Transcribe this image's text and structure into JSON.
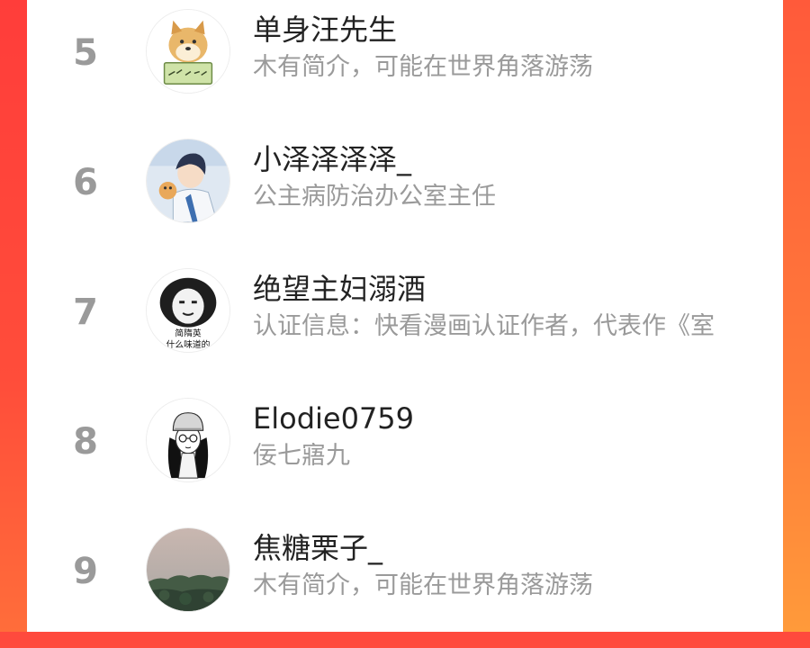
{
  "ranking": {
    "items": [
      {
        "rank": "5",
        "name": "单身汪先生",
        "bio": "木有简介，可能在世界角落游荡",
        "avatar": "doge-meme-avatar"
      },
      {
        "rank": "6",
        "name": "小泽泽泽泽_",
        "bio": "公主病防治办公室主任",
        "avatar": "anime-boy-avatar"
      },
      {
        "rank": "7",
        "name": "绝望主妇溺酒",
        "bio": "认证信息：快看漫画认证作者，代表作《室",
        "avatar": "panda-meme-avatar",
        "avatar_text": [
          "简隋英",
          "什么味道的"
        ]
      },
      {
        "rank": "8",
        "name": "Elodie0759",
        "bio": "佞七寤九",
        "avatar": "sketch-girl-avatar"
      },
      {
        "rank": "9",
        "name": "焦糖栗子_",
        "bio": "木有简介，可能在世界角落游荡",
        "avatar": "landscape-avatar"
      }
    ]
  },
  "colors": {
    "background_accent": "#ff5a3a",
    "rank_gray": "#9a9a9a",
    "name_dark": "#222222",
    "bio_gray": "#9a9a9a"
  }
}
